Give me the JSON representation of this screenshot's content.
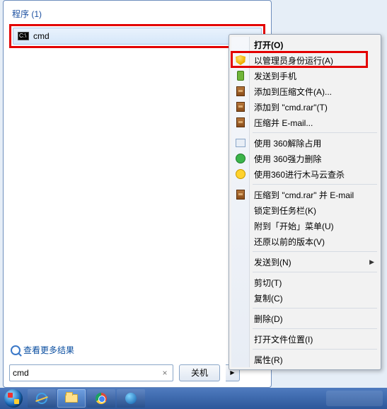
{
  "section_title": "程序 (1)",
  "result": {
    "label": "cmd"
  },
  "more_results": "查看更多结果",
  "search": {
    "value": "cmd",
    "clear": "×"
  },
  "shutdown": "关机",
  "split_arrow": "▶",
  "context_menu": {
    "open": "打开(O)",
    "run_as_admin": "以管理员身份运行(A)",
    "send_to_phone": "发送到手机",
    "add_archive": "添加到压缩文件(A)...",
    "add_cmd_rar": "添加到 \"cmd.rar\"(T)",
    "compress_email": "压缩并 E-mail...",
    "clear_360_occupy": "使用 360解除占用",
    "force_360_delete": "使用 360强力删除",
    "scan_360_cloud": "使用360进行木马云查杀",
    "compress_rar_email": "压缩到 \"cmd.rar\" 并 E-mail",
    "pin_taskbar": "锁定到任务栏(K)",
    "pin_start": "附到「开始」菜单(U)",
    "restore_prev": "还原以前的版本(V)",
    "send_to": "发送到(N)",
    "cut": "剪切(T)",
    "copy": "复制(C)",
    "delete": "删除(D)",
    "open_location": "打开文件位置(I)",
    "properties": "属性(R)"
  }
}
